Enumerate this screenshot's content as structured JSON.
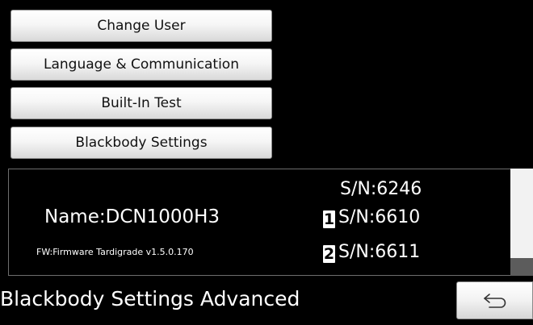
{
  "menu": {
    "buttons": [
      {
        "label": "Change User"
      },
      {
        "label": "Language & Communication"
      },
      {
        "label": "Built-In Test"
      },
      {
        "label": "Blackbody Settings"
      }
    ]
  },
  "device": {
    "name": "Name:DCN1000H3",
    "firmware": "FW:Firmware Tardigrade v1.5.0.170",
    "serial_main": "S/N:6246",
    "sources": [
      {
        "index": "1",
        "serial": "S/N:6610"
      },
      {
        "index": "2",
        "serial": "S/N:6611"
      }
    ]
  },
  "footer": {
    "title": "Blackbody Settings Advanced",
    "back_icon": "back-arrow-icon"
  }
}
